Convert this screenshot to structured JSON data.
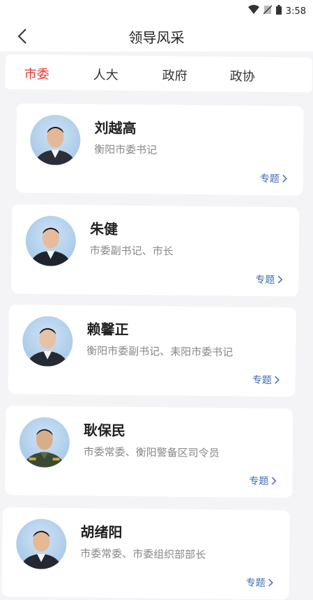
{
  "status_bar": {
    "time": "3:58"
  },
  "header": {
    "title": "领导风采"
  },
  "tabs": [
    {
      "label": "市委",
      "active": true
    },
    {
      "label": "人大",
      "active": false
    },
    {
      "label": "政府",
      "active": false
    },
    {
      "label": "政协",
      "active": false
    }
  ],
  "leaders": [
    {
      "name": "刘越高",
      "title": "衡阳市委书记",
      "link": "专题"
    },
    {
      "name": "朱健",
      "title": "市委副书记、市长",
      "link": "专题"
    },
    {
      "name": "赖馨正",
      "title": "衡阳市委副书记、耒阳市委书记",
      "link": "专题"
    },
    {
      "name": "耿保民",
      "title": "市委常委、衡阳警备区司令员",
      "link": "专题"
    },
    {
      "name": "胡绪阳",
      "title": "市委常委、市委组织部部长",
      "link": "专题"
    }
  ],
  "colors": {
    "accent": "#e53935",
    "link": "#3f6db8"
  }
}
